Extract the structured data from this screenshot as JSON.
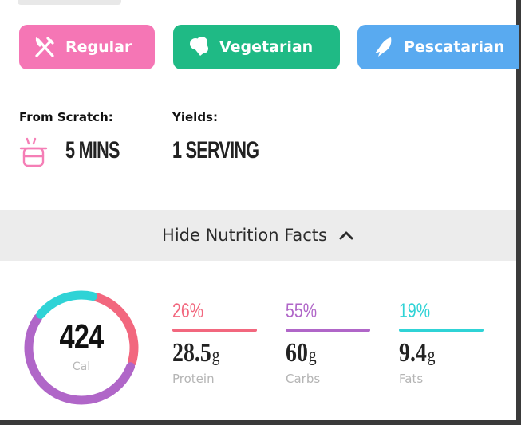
{
  "diets": [
    {
      "label": "Regular",
      "icon": "fork-knife-icon",
      "color": "#f576b5"
    },
    {
      "label": "Vegetarian",
      "icon": "broccoli-icon",
      "color": "#1fba85"
    },
    {
      "label": "Pescatarian",
      "icon": "fish-icon",
      "color": "#59aaf0"
    }
  ],
  "meta": {
    "scratch_label": "From Scratch:",
    "scratch_value": "5 MINS",
    "scratch_icon": "cooking-pot-icon",
    "yields_label": "Yields:",
    "yields_value": "1 SERVING"
  },
  "nutrition_toggle": {
    "label": "Hide Nutrition Facts",
    "icon": "chevron-up-icon"
  },
  "nutrition": {
    "calories": "424",
    "calories_unit": "Cal",
    "macros": [
      {
        "percent": "26%",
        "percent_value": 26,
        "amount": "28.5",
        "unit": "g",
        "name": "Protein",
        "color": "#f2677e"
      },
      {
        "percent": "55%",
        "percent_value": 55,
        "amount": "60",
        "unit": "g",
        "name": "Carbs",
        "color": "#b066c8"
      },
      {
        "percent": "19%",
        "percent_value": 19,
        "amount": "9.4",
        "unit": "g",
        "name": "Fats",
        "color": "#2fd3d6"
      }
    ]
  }
}
